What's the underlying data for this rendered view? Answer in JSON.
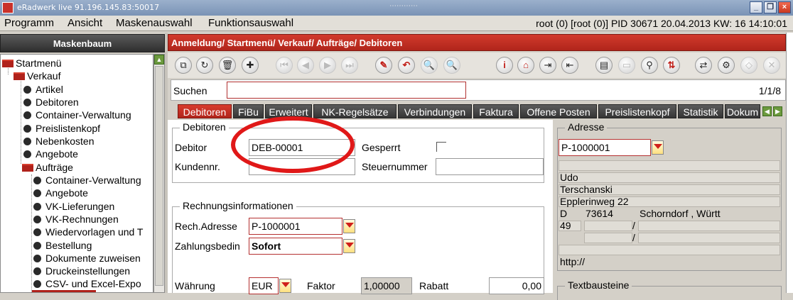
{
  "window": {
    "title": "eRadwerk live 91.196.145.83:50017"
  },
  "menu": {
    "items": [
      "Programm",
      "Ansicht",
      "Maskenauswahl",
      "Funktionsauswahl"
    ],
    "status": "root (0) [root (0)] PID 30671 20.04.2013 KW: 16 14:10:01"
  },
  "left_panel": {
    "header": "Maskenbaum",
    "tree": [
      {
        "label": "Startmenü",
        "level": 0,
        "type": "folder"
      },
      {
        "label": "Verkauf",
        "level": 1,
        "type": "folder"
      },
      {
        "label": "Artikel",
        "level": 2,
        "type": "leaf"
      },
      {
        "label": "Debitoren",
        "level": 2,
        "type": "leaf"
      },
      {
        "label": "Container-Verwaltung",
        "level": 2,
        "type": "leaf"
      },
      {
        "label": "Preislistenkopf",
        "level": 2,
        "type": "leaf"
      },
      {
        "label": "Nebenkosten",
        "level": 2,
        "type": "leaf"
      },
      {
        "label": "Angebote",
        "level": 2,
        "type": "leaf"
      },
      {
        "label": "Aufträge",
        "level": 2,
        "type": "folder"
      },
      {
        "label": "Container-Verwaltung",
        "level": 3,
        "type": "leaf"
      },
      {
        "label": "Angebote",
        "level": 3,
        "type": "leaf"
      },
      {
        "label": "VK-Lieferungen",
        "level": 3,
        "type": "leaf"
      },
      {
        "label": "VK-Rechnungen",
        "level": 3,
        "type": "leaf"
      },
      {
        "label": "Wiedervorlagen und T",
        "level": 3,
        "type": "leaf"
      },
      {
        "label": "Bestellung",
        "level": 3,
        "type": "leaf"
      },
      {
        "label": "Dokumente zuweisen",
        "level": 3,
        "type": "leaf"
      },
      {
        "label": "Druckeinstellungen",
        "level": 3,
        "type": "leaf"
      },
      {
        "label": "CSV- und Excel-Expo",
        "level": 3,
        "type": "leaf"
      }
    ]
  },
  "breadcrumb": "Anmeldung/ Startmenü/ Verkauf/ Aufträge/ Debitoren",
  "search": {
    "label": "Suchen",
    "value": "",
    "counter": "1/1/8"
  },
  "tabs": [
    {
      "label": "Debitoren",
      "active": true
    },
    {
      "label": "FiBu",
      "active": false
    },
    {
      "label": "Erweitert",
      "active": false
    },
    {
      "label": "NK-Regelsätze",
      "active": false
    },
    {
      "label": "Verbindungen",
      "active": false
    },
    {
      "label": "Faktura",
      "active": false
    },
    {
      "label": "Offene Posten",
      "active": false
    },
    {
      "label": "Preislistenkopf",
      "active": false
    },
    {
      "label": "Statistik",
      "active": false
    },
    {
      "label": "Dokum",
      "active": false
    }
  ],
  "debitoren": {
    "title": "Debitoren",
    "debitor_label": "Debitor",
    "debitor_value": "DEB-00001",
    "gesperrt_label": "Gesperrt",
    "kundennr_label": "Kundennr.",
    "kundennr_value": "",
    "steuernummer_label": "Steuernummer",
    "steuernummer_value": ""
  },
  "rechnung": {
    "title": "Rechnungsinformationen",
    "adresse_label": "Rech.Adresse",
    "adresse_value": "P-1000001",
    "zahlung_label": "Zahlungsbedin",
    "zahlung_value": "Sofort",
    "waehrung_label": "Währung",
    "waehrung_value": "EUR",
    "faktor_label": "Faktor",
    "faktor_value": "1,00000",
    "rabatt_label": "Rabatt",
    "rabatt_value": "0,00"
  },
  "adresse": {
    "title": "Adresse",
    "value": "P-1000001",
    "firstname": "Udo",
    "lastname": "Terschanski",
    "street": "Epplerinweg 22",
    "country": "D",
    "zip": "73614",
    "city": "Schorndorf , Württ",
    "phone_prefix": "49",
    "slash1": "/",
    "slash2": "/",
    "web": "http://"
  },
  "textbausteine": {
    "title": "Textbausteine"
  },
  "colors": {
    "accent": "#c0281d",
    "tab_dark": "#3c3c3c",
    "panel": "#d4d0c8"
  }
}
